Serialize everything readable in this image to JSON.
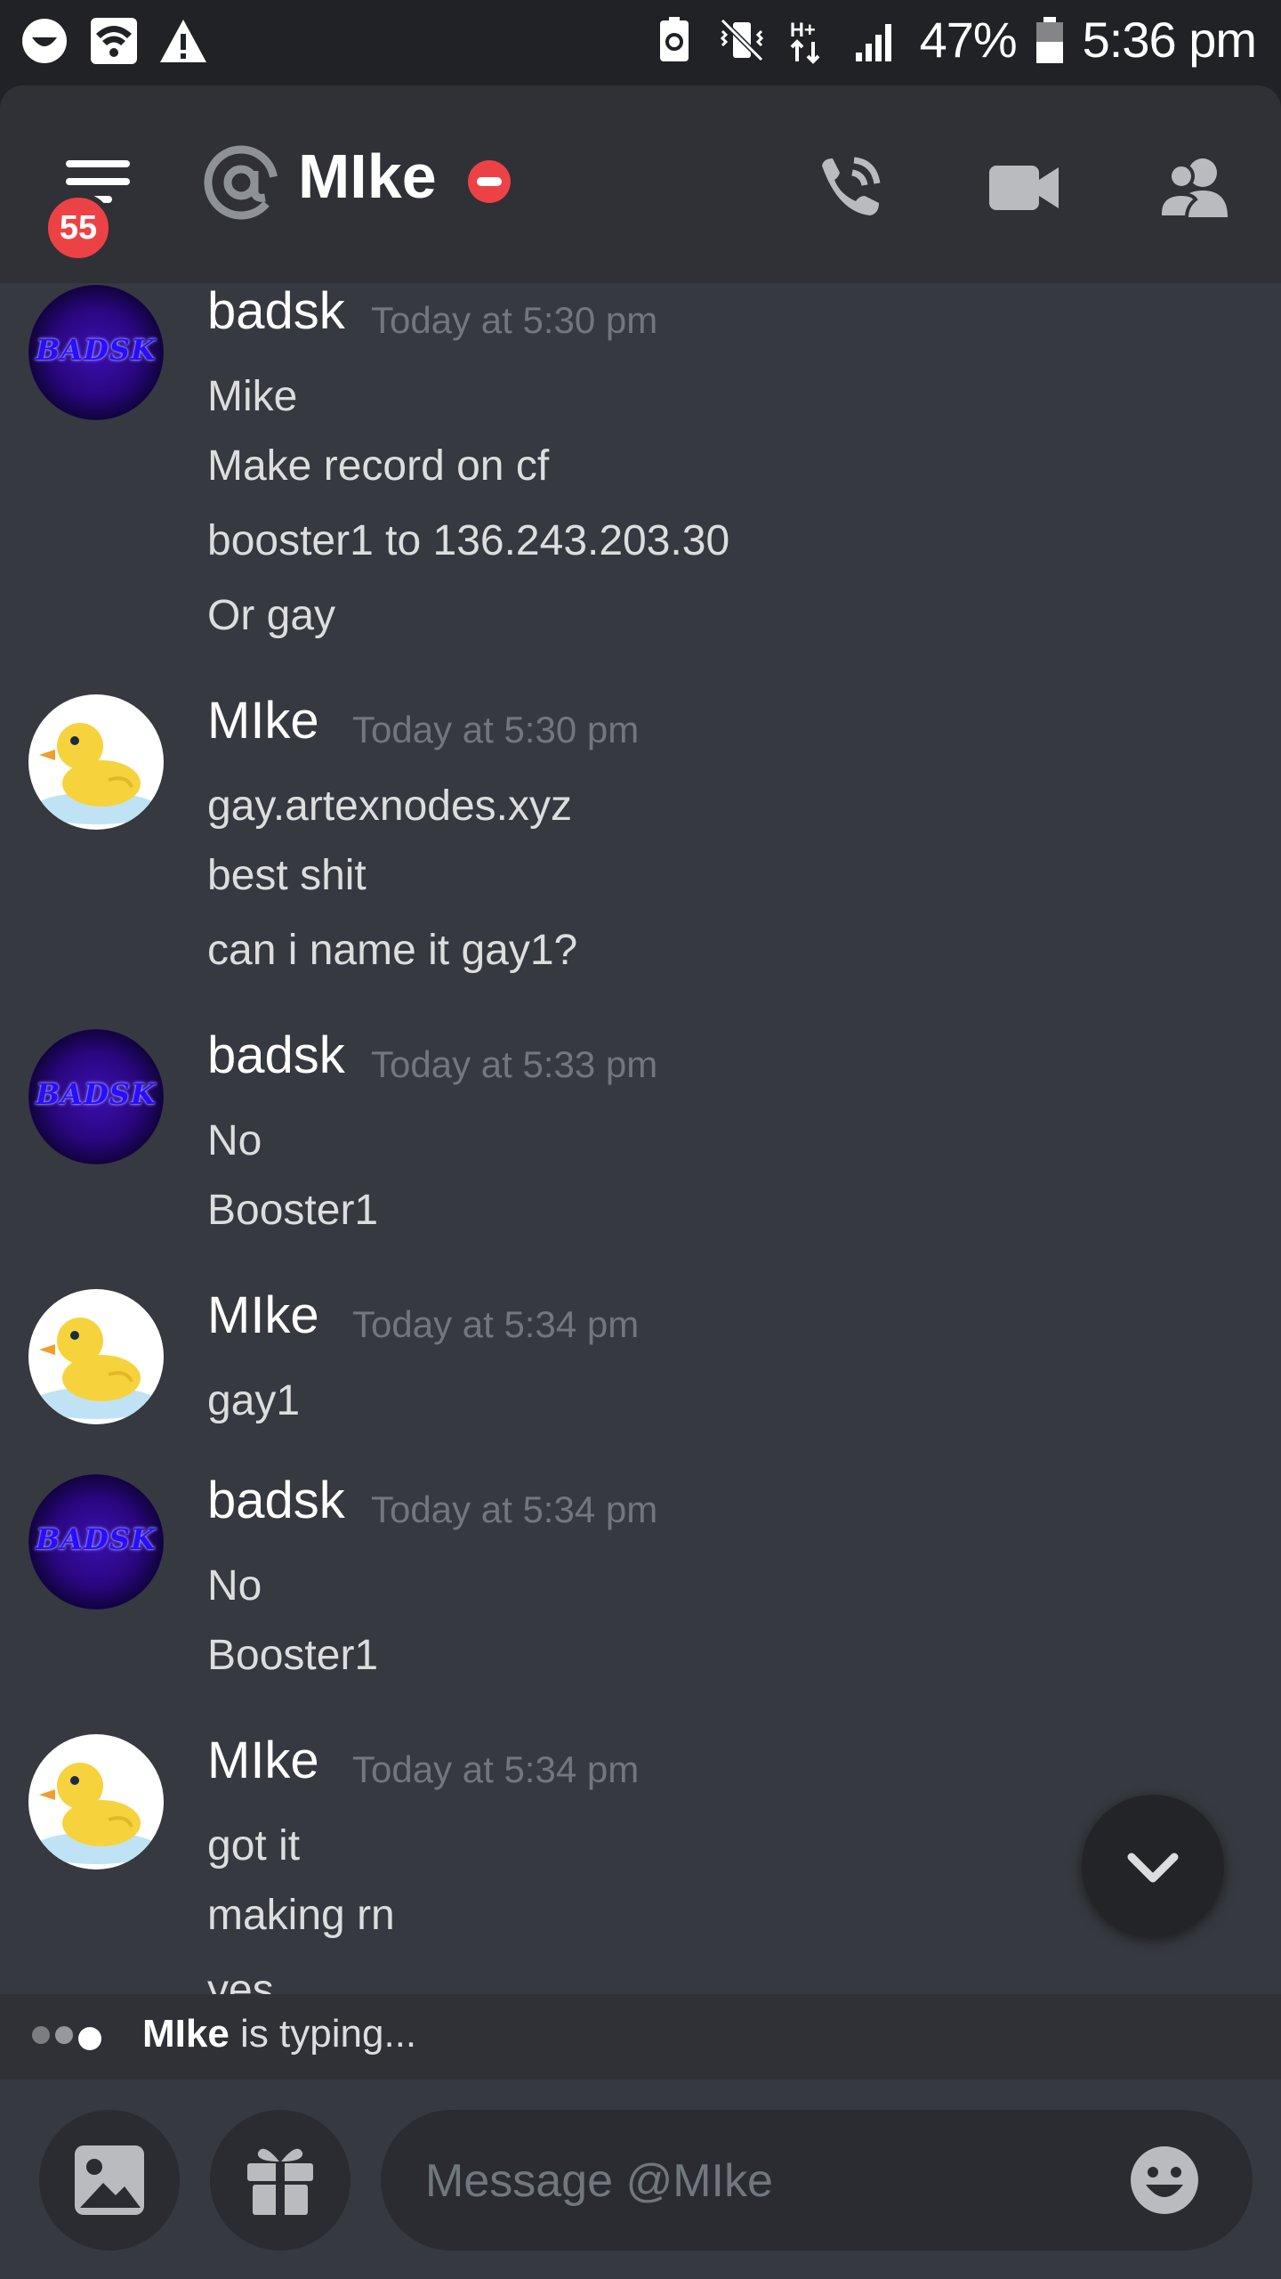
{
  "status_bar": {
    "battery_percent": "47%",
    "time": "5:36 pm"
  },
  "header": {
    "unread_badge": "55",
    "channel_name": "MIke"
  },
  "messages": [
    {
      "author": "badsk",
      "timestamp": "Today at 5:30 pm",
      "avatar": "badsk-avatar",
      "avatar_text": "BADSK",
      "lines": [
        "Mike",
        "Make record on cf",
        "booster1 to 136.243.203.30",
        "Or gay"
      ]
    },
    {
      "author": "MIke",
      "timestamp": "Today at 5:30 pm",
      "avatar": "duck-avatar",
      "lines": [
        "gay.artexnodes.xyz",
        "best shit",
        "can i name it gay1?"
      ]
    },
    {
      "author": "badsk",
      "timestamp": "Today at 5:33 pm",
      "avatar": "badsk-avatar",
      "avatar_text": "BADSK",
      "lines": [
        "No",
        "Booster1"
      ]
    },
    {
      "author": "MIke",
      "timestamp": "Today at 5:34 pm",
      "avatar": "duck-avatar",
      "lines": [
        "gay1"
      ]
    },
    {
      "author": "badsk",
      "timestamp": "Today at 5:34 pm",
      "avatar": "badsk-avatar",
      "avatar_text": "BADSK",
      "lines": [
        "No",
        "Booster1"
      ]
    },
    {
      "author": "MIke",
      "timestamp": "Today at 5:34 pm",
      "avatar": "duck-avatar",
      "lines": [
        "got it",
        "making rn",
        "yes"
      ]
    }
  ],
  "typing": {
    "user": "MIke",
    "suffix": " is typing..."
  },
  "composer": {
    "placeholder": "Message @MIke"
  },
  "icons": {
    "status_left": [
      "face-icon",
      "wifi-icon",
      "warning-icon"
    ],
    "status_right": [
      "battery-saver-icon",
      "vibrate-mute-icon",
      "data-icon",
      "signal-icon",
      "battery-icon"
    ],
    "header": [
      "menu-icon",
      "at-icon",
      "dnd-status-icon",
      "call-icon",
      "video-icon",
      "members-icon"
    ],
    "composer": [
      "image-icon",
      "gift-icon",
      "emoji-icon"
    ],
    "scroll": "chevron-down-icon"
  },
  "colors": {
    "background": "#36393f",
    "header": "#2f3136",
    "status_bar": "#202225",
    "dnd": "#ed4245",
    "timestamp": "#72767d"
  }
}
